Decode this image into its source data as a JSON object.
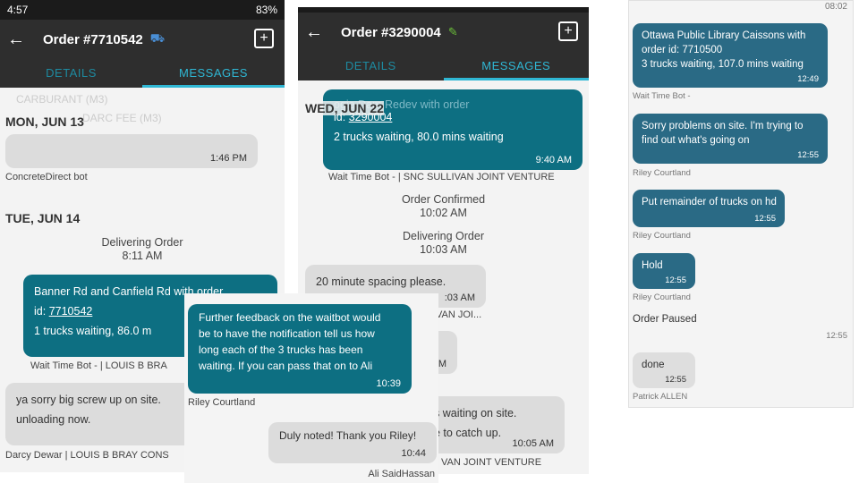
{
  "panel1": {
    "statusbar": {
      "left": "4:57",
      "right": "83%"
    },
    "header": {
      "title": "Order #7710542"
    },
    "tabs": [
      "DETAILS",
      "MESSAGES"
    ],
    "faded_lines": [
      "CARBURANT (M3)",
      "DARC FEE (M3)"
    ],
    "day1": "MON, JUN 13",
    "msg1": {
      "time": "1:46 PM",
      "sender": "ConcreteDirect bot"
    },
    "day2": "TUE, JUN 14",
    "sys1": {
      "text": "Delivering Order",
      "time": "8:11 AM"
    },
    "msg2": {
      "line1": "Banner Rd and Canfield Rd  with order",
      "id_label": "id:",
      "id": "7710542",
      "line3": "1  trucks waiting,  86.0  m",
      "sender": "Wait Time Bot - | LOUIS B BRA"
    },
    "msg3": {
      "line1": "ya sorry big screw up on site.",
      "line2": "unloading now.",
      "sender": "Darcy Dewar | LOUIS B BRAY CONS"
    }
  },
  "panel2": {
    "statusbar": {
      "right": ""
    },
    "header": {
      "title": "Order #3290004"
    },
    "tabs": [
      "DETAILS",
      "MESSAGES"
    ],
    "day": "WED, JUN 22",
    "msg1": {
      "line1": "ogie Dam Redev  with order",
      "id_label": "id:",
      "id": "3290004",
      "line3": "2  trucks waiting,  80.0  mins waiting",
      "time": "9:40 AM",
      "sender": "Wait Time Bot - | SNC SULLIVAN JOINT VENTURE"
    },
    "sys1": {
      "text": "Order Confirmed",
      "time": "10:02 AM"
    },
    "sys2": {
      "text": "Delivering Order",
      "time": "10:03 AM"
    },
    "msg2": {
      "text": "20 minute spacing please.",
      "time": ":03 AM",
      "sender": "VAN JOI..."
    },
    "msg3": {
      "time": "M"
    },
    "msg4": {
      "line1": "s waiting on site.",
      "line2": "e to catch up.",
      "time": "10:05 AM",
      "sender": "VAN JOINT VENTURE"
    }
  },
  "overlay": {
    "msg1": {
      "line1": "Further feedback on the waitbot would",
      "line2": "be to have the notification tell us how",
      "line3": "long each of the 3 trucks has been",
      "line4": "waiting. If you can pass that on to Ali",
      "time": "10:39",
      "sender": "Riley Courtland"
    },
    "msg2": {
      "text": "Duly noted! Thank you Riley!",
      "time": "10:44",
      "sender": "Ali SaidHassan"
    }
  },
  "panel4": {
    "top_time": "08:02",
    "msg1": {
      "line1": "Ottawa Public Library Caissons  with",
      "line2": "order id:  7710500",
      "line3": "3  trucks waiting,  107.0  mins waiting",
      "time": "12:49",
      "sender": "Wait Time Bot -"
    },
    "msg2": {
      "line1": "Sorry problems on site. I'm trying to",
      "line2": "find out what's going on",
      "time": "12:55",
      "sender": "Riley Courtland"
    },
    "msg3": {
      "text": "Put remainder of trucks on hd",
      "time": "12:55",
      "sender": "Riley Courtland"
    },
    "msg4": {
      "text": "Hold",
      "time": "12:55",
      "sender": "Riley Courtland"
    },
    "sys": {
      "text": "Order Paused",
      "time": "12:55"
    },
    "msg5": {
      "text": "done",
      "time": "12:55",
      "sender": "Patrick ALLEN"
    }
  },
  "colors": {
    "teal_bubble": "#0d6f82",
    "grey_bubble": "#dcdcdc",
    "appbar": "#2e2e2e",
    "tab_active": "#2fb7d4"
  },
  "icons": [
    "back-arrow-icon",
    "truck-icon",
    "edit-icon",
    "add-box-icon"
  ]
}
